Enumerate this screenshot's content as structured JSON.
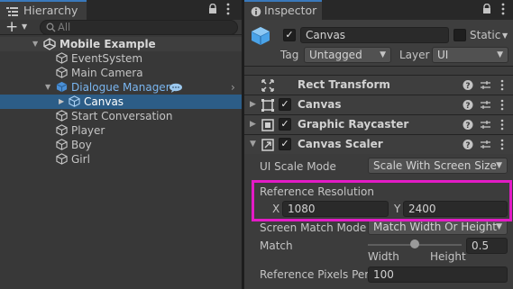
{
  "hierarchy": {
    "tab_label": "Hierarchy",
    "add_label": "+",
    "search_placeholder": "All",
    "items": [
      {
        "label": "Mobile Example"
      },
      {
        "label": "EventSystem"
      },
      {
        "label": "Main Camera"
      },
      {
        "label": "Dialogue Manager"
      },
      {
        "label": "Canvas"
      },
      {
        "label": "Start Conversation"
      },
      {
        "label": "Player"
      },
      {
        "label": "Boy"
      },
      {
        "label": "Girl"
      }
    ]
  },
  "inspector": {
    "tab_label": "Inspector",
    "object_name": "Canvas",
    "static_label": "Static",
    "tag_label": "Tag",
    "tag_value": "Untagged",
    "layer_label": "Layer",
    "layer_value": "UI",
    "components": [
      {
        "name": "Rect Transform"
      },
      {
        "name": "Canvas"
      },
      {
        "name": "Graphic Raycaster"
      },
      {
        "name": "Canvas Scaler"
      }
    ],
    "ui_scale_mode_label": "UI Scale Mode",
    "ui_scale_mode_value": "Scale With Screen Size",
    "reference_resolution_label": "Reference Resolution",
    "x_label": "X",
    "x_value": "1080",
    "y_label": "Y",
    "y_value": "2400",
    "screen_match_mode_label": "Screen Match Mode",
    "screen_match_mode_value": "Match Width Or Height",
    "match_label": "Match",
    "match_value": "0.5",
    "match_fraction": 0.5,
    "width_label": "Width",
    "height_label": "Height",
    "ref_pixels_label": "Reference Pixels Per",
    "ref_pixels_value": "100"
  },
  "colors": {
    "selection": "#2c5d87",
    "highlight_border": "#e31bc6",
    "prefab_blue": "#7ab6f0",
    "tab_accent": "#3a79bb"
  },
  "icons": [
    "hierarchy-icon",
    "lock-icon",
    "more-icon",
    "add-icon",
    "dropdown-arrow-icon",
    "search-icon",
    "unity-scene-icon",
    "gameobject-cube-icon",
    "prefab-cube-icon",
    "chat-bubble-icon",
    "inspector-icon",
    "rect-transform-icon",
    "canvas-icon",
    "raycaster-icon",
    "canvas-scaler-icon",
    "help-icon",
    "preset-icon",
    "kebab-icon"
  ]
}
